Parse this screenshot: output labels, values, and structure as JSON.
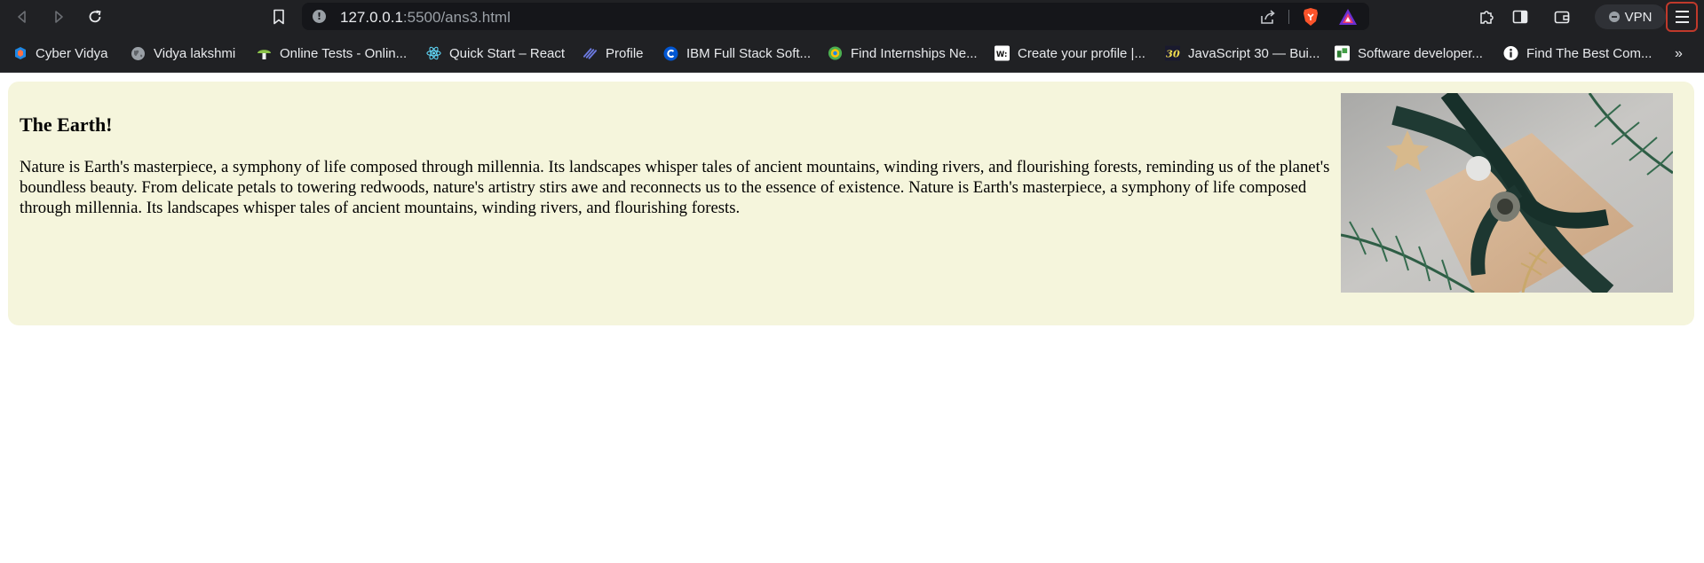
{
  "browser": {
    "url_host": "127.0.0.1",
    "url_path": ":5500/ans3.html",
    "vpn_label": "VPN",
    "bookmarks": [
      {
        "label": "Cyber Vidya",
        "icon": "cyber-vidya-icon"
      },
      {
        "label": "Vidya lakshmi",
        "icon": "globe-icon"
      },
      {
        "label": "Online Tests - Onlin...",
        "icon": "mushroom-icon"
      },
      {
        "label": "Quick Start – React",
        "icon": "react-icon"
      },
      {
        "label": "Profile",
        "icon": "profile-icon"
      },
      {
        "label": "IBM Full Stack Soft...",
        "icon": "coursera-icon"
      },
      {
        "label": "Find Internships Ne...",
        "icon": "internship-icon"
      },
      {
        "label": "Create your profile |...",
        "icon": "w-icon"
      },
      {
        "label": "JavaScript 30 — Bui...",
        "icon": "js30-icon"
      },
      {
        "label": "Software developer...",
        "icon": "naukri-icon"
      },
      {
        "label": "Find The Best Com...",
        "icon": "info-icon"
      }
    ],
    "more_label": "»"
  },
  "page": {
    "title": "The Earth!",
    "paragraph": "Nature is Earth's masterpiece, a symphony of life composed through millennia. Its landscapes whisper tales of ancient mountains, winding rivers, and flourishing forests, reminding us of the planet's boundless beauty. From delicate petals to towering redwoods, nature's artistry stirs awe and reconnects us to the essence of existence. Nature is Earth's masterpiece, a symphony of life composed through millennia. Its landscapes whisper tales of ancient mountains, winding rivers, and flourishing forests.",
    "card_background": "#f5f5dc"
  }
}
